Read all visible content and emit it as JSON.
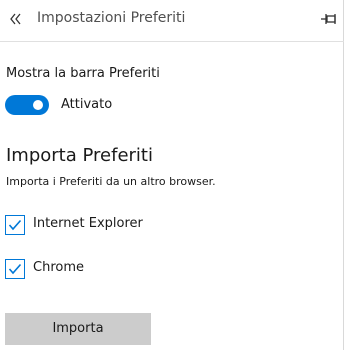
{
  "header": {
    "title": "Impostazioni Preferiti",
    "back_icon": "double-chevron-left-icon",
    "pin_icon": "pin-icon"
  },
  "favorites_bar": {
    "label": "Mostra la barra Preferiti",
    "toggle_state": "Attivato",
    "enabled": true
  },
  "import_section": {
    "title": "Importa Preferiti",
    "description": "Importa i Preferiti da un altro browser.",
    "browsers": [
      {
        "label": "Internet Explorer",
        "checked": true
      },
      {
        "label": "Chrome",
        "checked": true
      }
    ],
    "button_label": "Importa"
  },
  "colors": {
    "accent": "#0078d7",
    "button_bg": "#cccccc"
  }
}
